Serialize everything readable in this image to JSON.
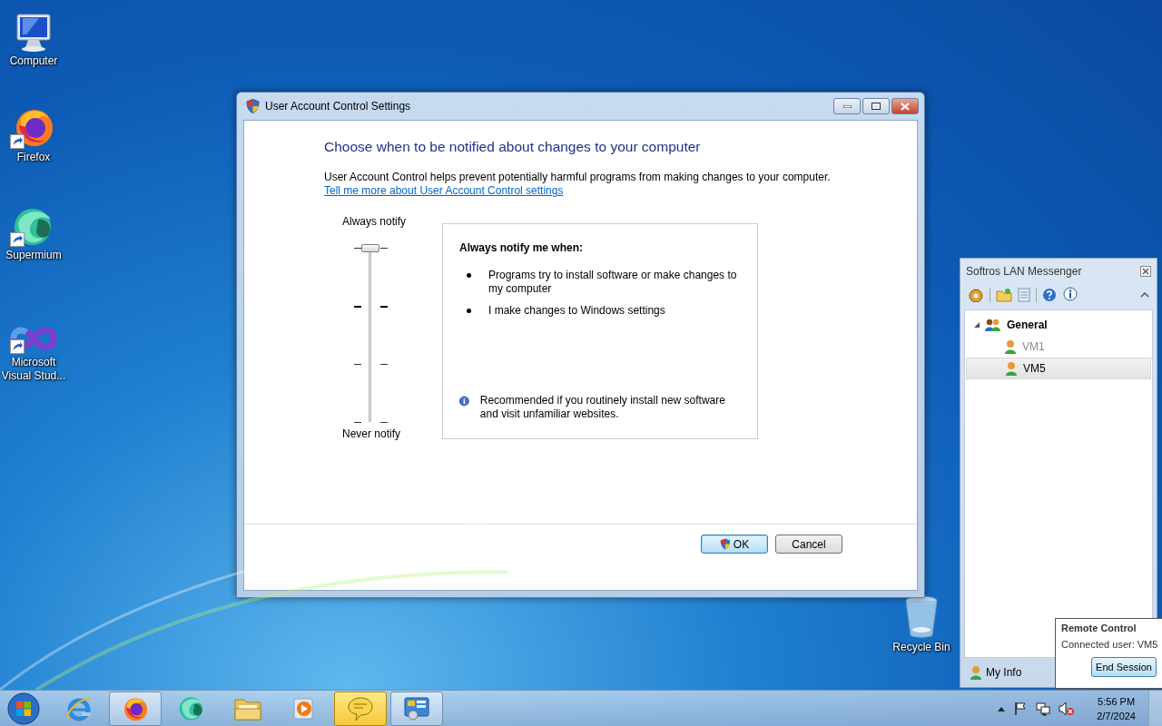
{
  "desktop_icons": [
    {
      "kind": "computer",
      "label": "Computer"
    },
    {
      "kind": "firefox",
      "label": "Firefox"
    },
    {
      "kind": "supermium",
      "label": "Supermium"
    },
    {
      "kind": "visual-studio",
      "label": "Microsoft Visual Stud..."
    },
    {
      "kind": "recycle-bin",
      "label": "Recycle Bin"
    }
  ],
  "window": {
    "title": "User Account Control Settings",
    "heading": "Choose when to be notified about changes to your computer",
    "description": "User Account Control helps prevent potentially harmful programs from making changes to your computer.",
    "link": "Tell me more about User Account Control settings",
    "slider": {
      "top_label": "Always notify",
      "bottom_label": "Never notify",
      "level": 1
    },
    "info": {
      "heading": "Always notify me when:",
      "bullets": [
        "Programs try to install software or make changes to my computer",
        "I make changes to Windows settings"
      ],
      "note": "Recommended if you routinely install new software and visit unfamiliar websites."
    },
    "buttons": [
      {
        "label": "OK",
        "focused": true
      },
      {
        "label": "Cancel",
        "focused": false
      }
    ]
  },
  "messenger": {
    "title": "Softros LAN Messenger",
    "groups": [
      {
        "label": "General",
        "expanded": true,
        "children": [
          {
            "label": "VM1",
            "selected": false,
            "disabled": true
          },
          {
            "label": "VM5",
            "selected": true,
            "disabled": false
          }
        ]
      }
    ],
    "my_info": "My Info"
  },
  "remote_popup": {
    "title": "Remote Control",
    "text": "Connected user:  VM5",
    "button": "End Session"
  },
  "taskbar": {
    "items": [
      {
        "kind": "ie",
        "running": false,
        "flashing": false
      },
      {
        "kind": "firefox",
        "running": true,
        "flashing": false
      },
      {
        "kind": "supermium",
        "running": false,
        "flashing": false
      },
      {
        "kind": "explorer",
        "running": false,
        "flashing": false
      },
      {
        "kind": "media",
        "running": false,
        "flashing": false
      },
      {
        "kind": "messenger",
        "running": true,
        "flashing": true
      },
      {
        "kind": "control-panel",
        "running": true,
        "flashing": false
      }
    ],
    "time": "5:56 PM",
    "date": "2/7/2024"
  }
}
